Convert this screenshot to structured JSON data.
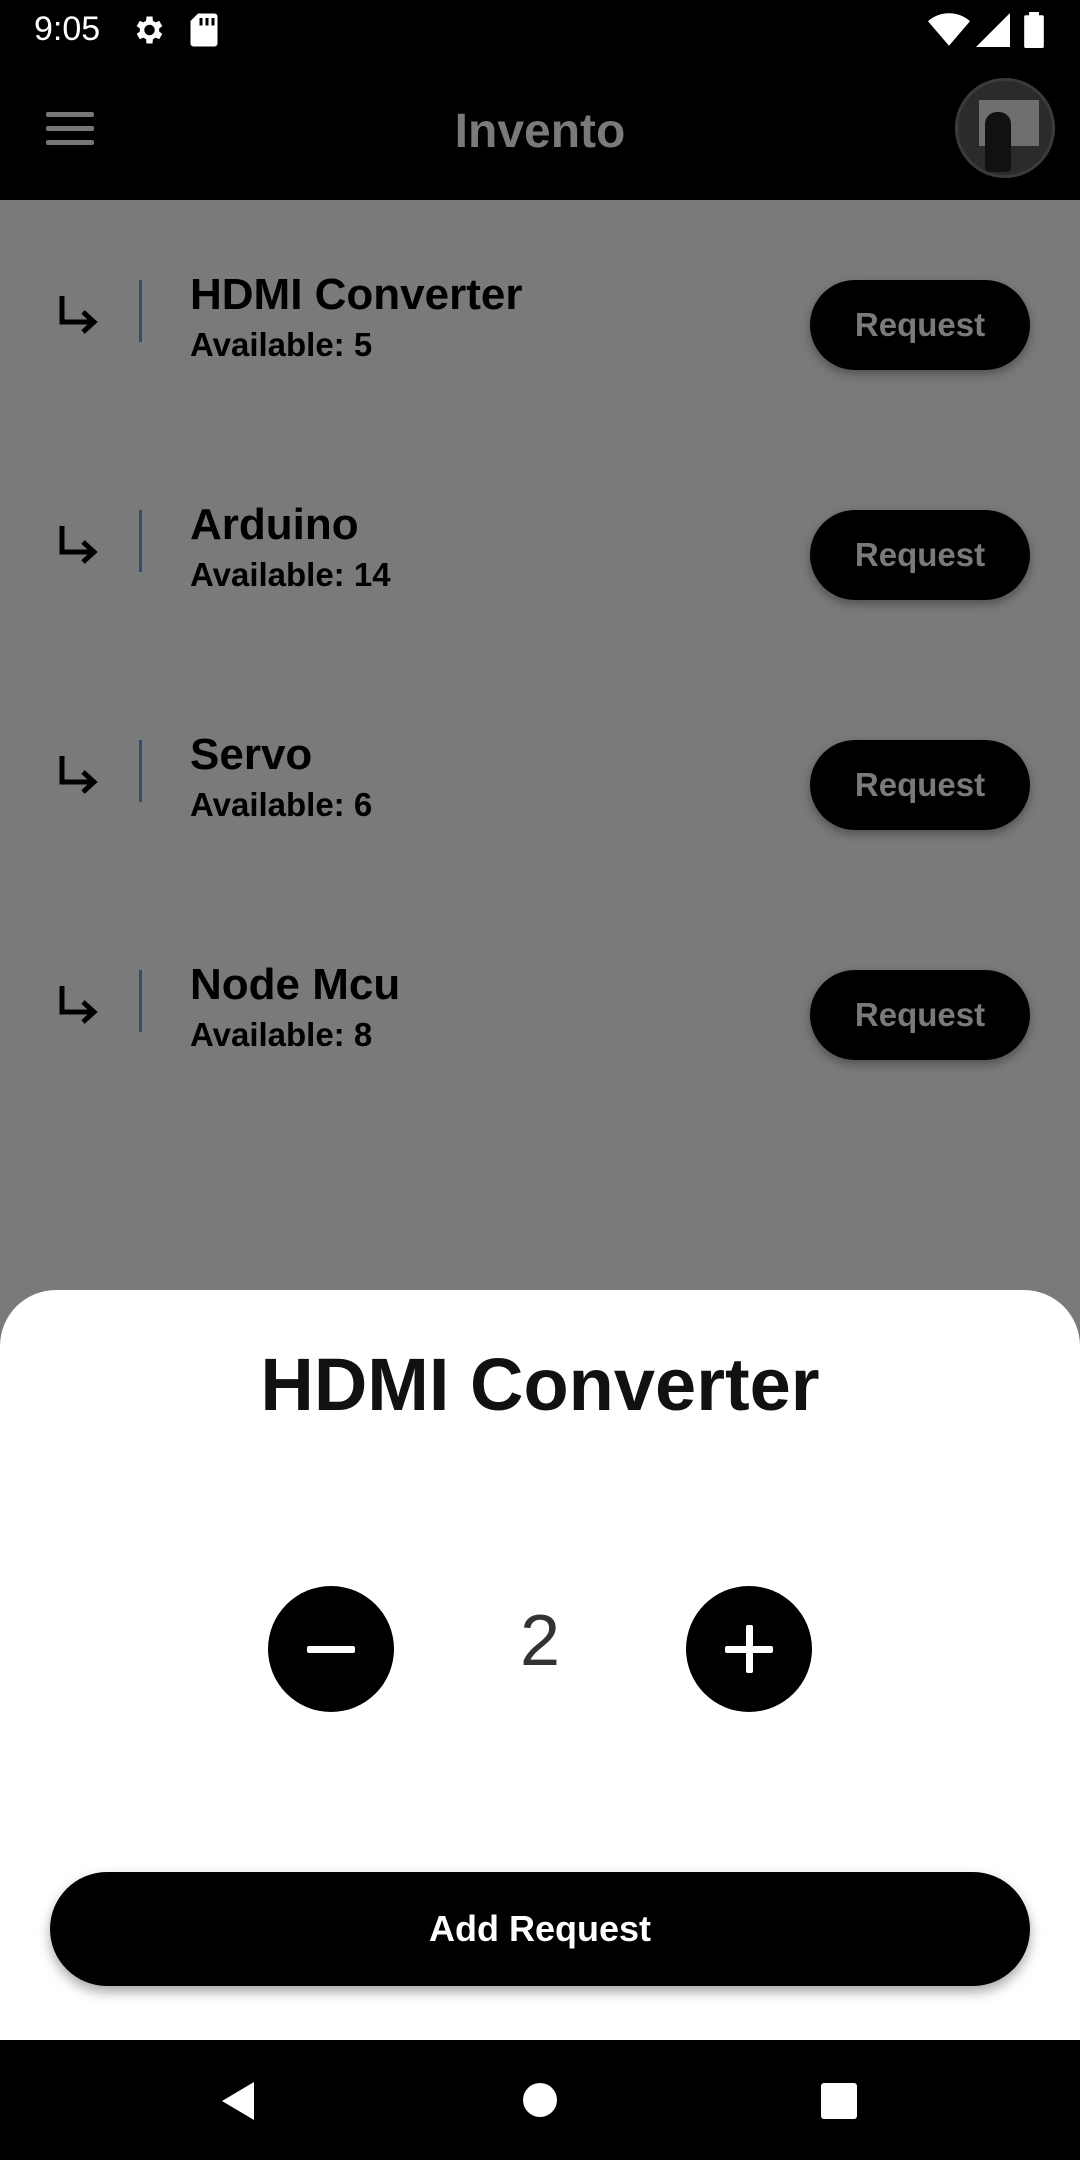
{
  "status_bar": {
    "time": "9:05",
    "icons_left": [
      "gear-icon",
      "sd-card-icon"
    ],
    "icons_right": [
      "wifi-icon",
      "cell-signal-icon",
      "battery-icon"
    ]
  },
  "app_bar": {
    "title": "Invento",
    "menu_icon": "hamburger-menu-icon",
    "avatar": "profile-avatar"
  },
  "items": [
    {
      "name": "HDMI Converter",
      "available": "Available: 5",
      "button": "Request"
    },
    {
      "name": "Arduino",
      "available": "Available: 14",
      "button": "Request"
    },
    {
      "name": "Servo",
      "available": "Available: 6",
      "button": "Request"
    },
    {
      "name": "Node Mcu",
      "available": "Available: 8",
      "button": "Request"
    }
  ],
  "sheet": {
    "title": "HDMI Converter",
    "quantity": "2",
    "decrement_icon": "minus-icon",
    "increment_icon": "plus-icon",
    "add_button": "Add Request"
  },
  "nav_bar": {
    "icons": [
      "back-icon",
      "home-icon",
      "recents-icon"
    ]
  },
  "colors": {
    "background_dim": "#7a7a7a",
    "bar": "#000000",
    "divider": "#2d4f72",
    "sheet": "#ffffff"
  }
}
